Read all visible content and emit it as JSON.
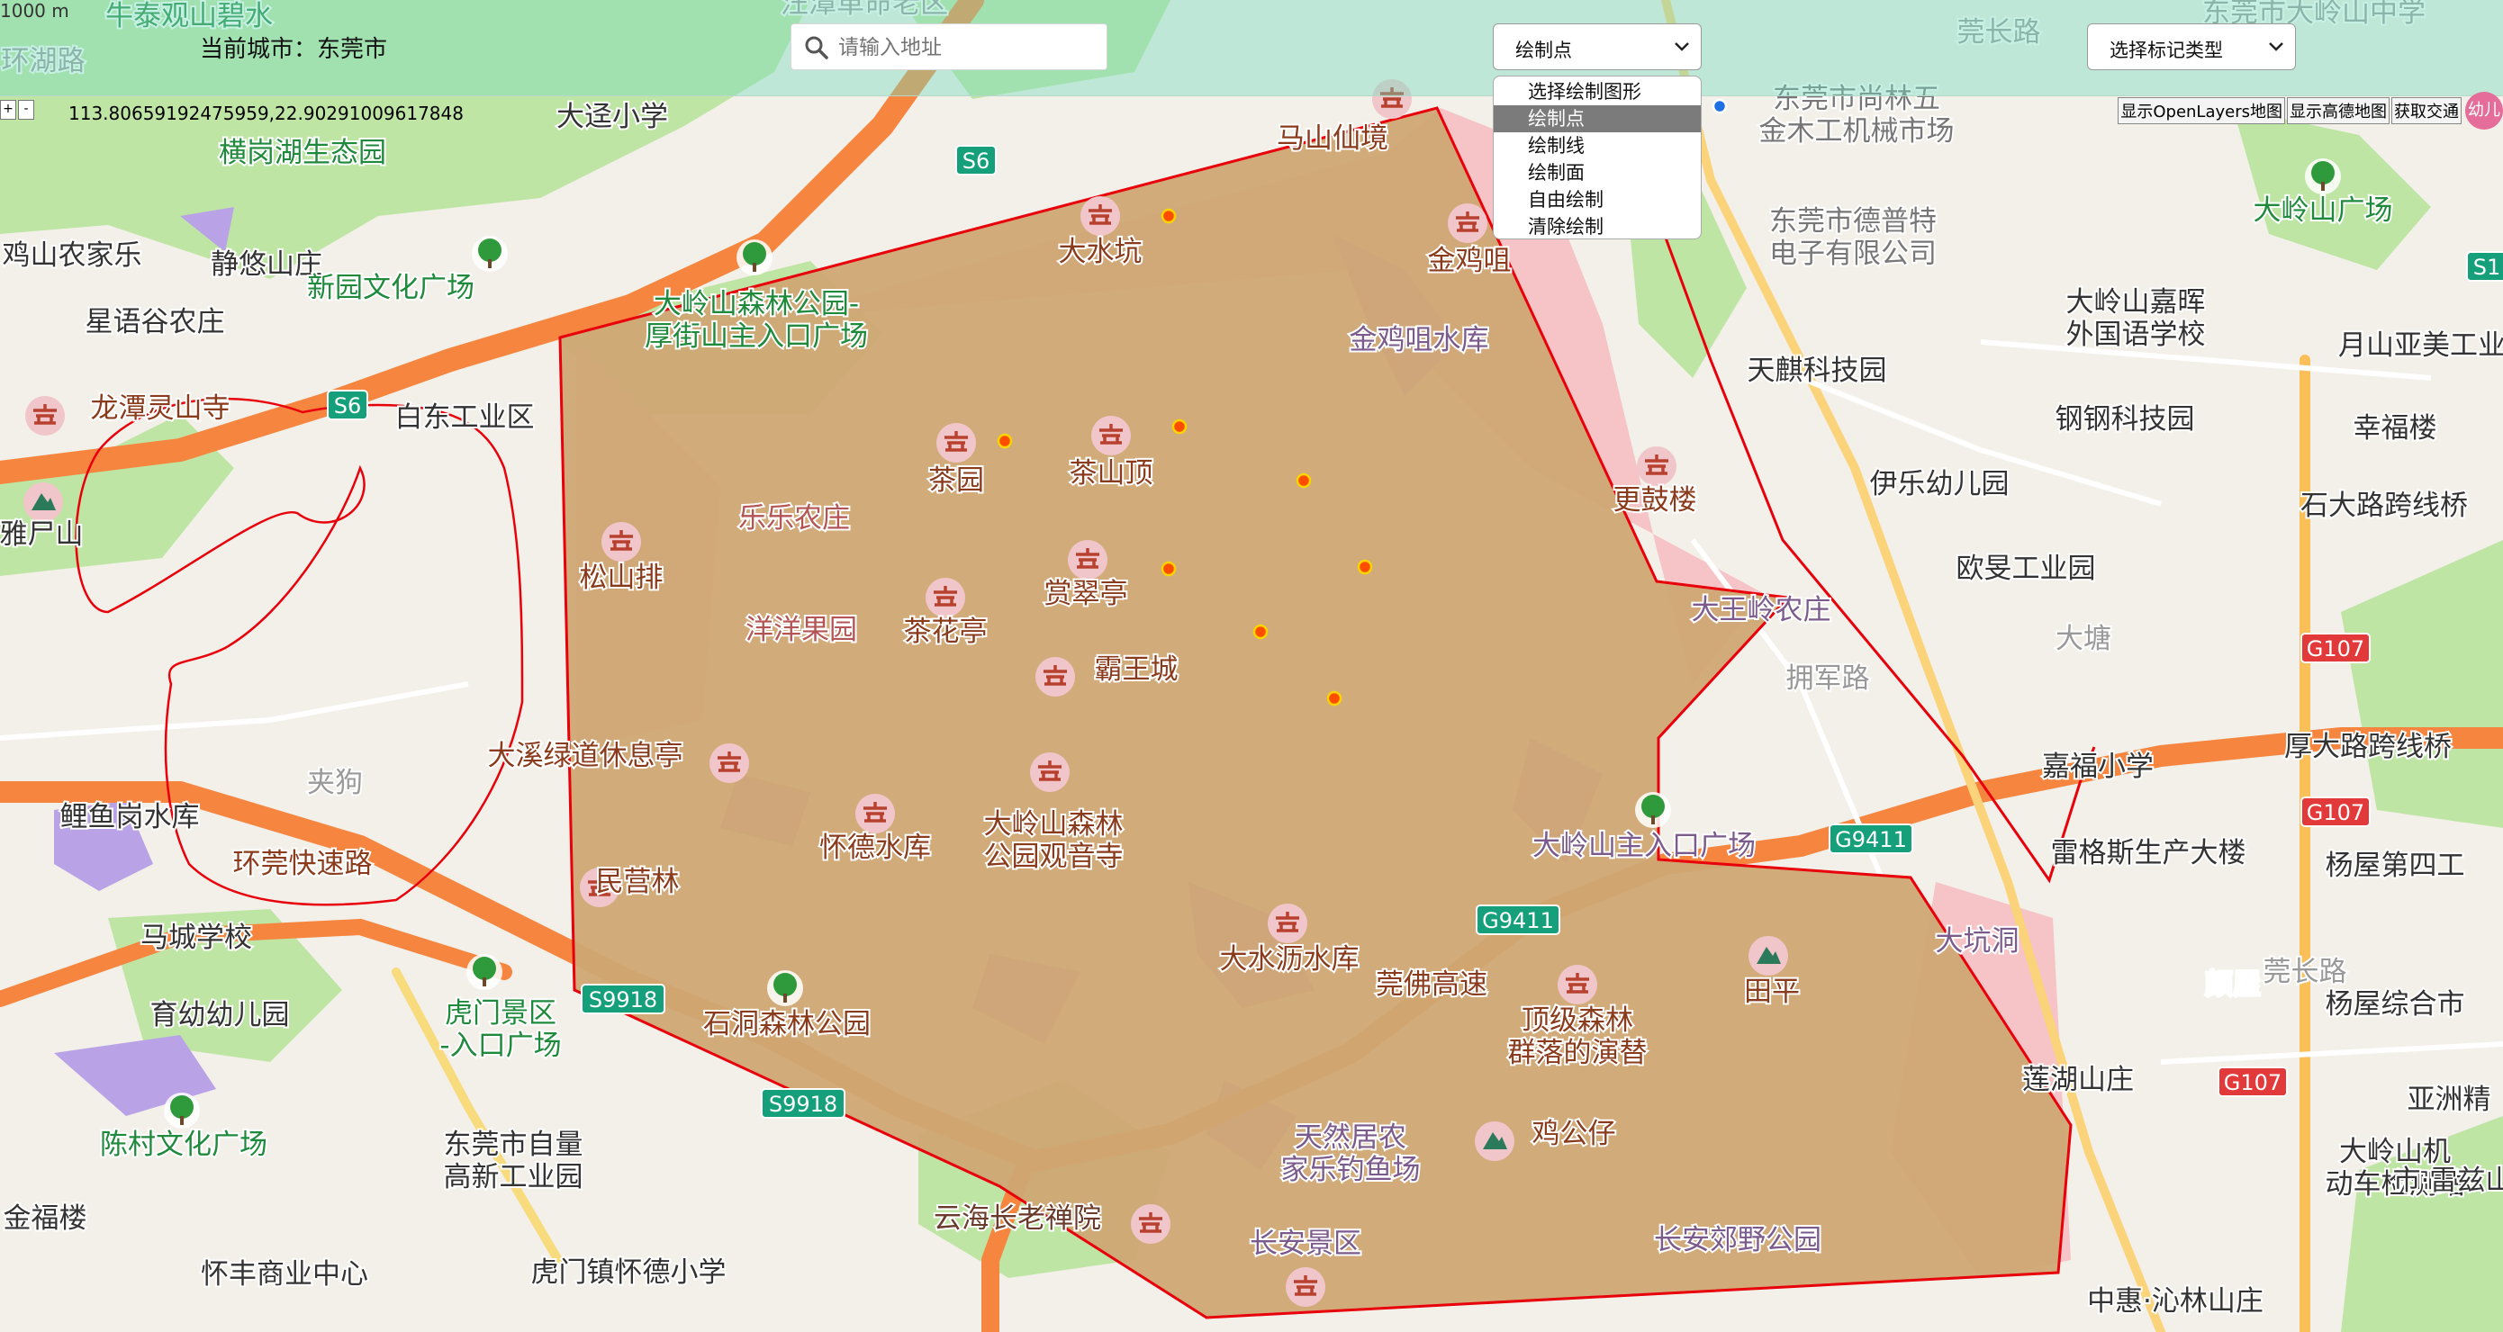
{
  "topbar": {
    "current_city": "当前城市：东莞市",
    "search_placeholder": "请输入地址",
    "draw_select_value": "绘制点",
    "draw_options": [
      "选择绘制图形",
      "绘制点",
      "绘制线",
      "绘制面",
      "自由绘制",
      "清除绘制"
    ],
    "mark_select_value": "选择标记类型"
  },
  "map_controls": {
    "scale": "1000 m",
    "coordinates": "113.80659192475959,22.90291009617848",
    "zoom_in": "+",
    "zoom_out": "-",
    "buttons": [
      "显示OpenLayers地图",
      "显示高德地图",
      "获取交通"
    ],
    "avatar_text": "幼儿"
  },
  "map_labels": [
    "大水坑",
    "金鸡咀",
    "马山仙境",
    "茶园",
    "茶山顶",
    "金鸡咀水库",
    "松山排",
    "乐乐农庄",
    "洋洋果园",
    "茶花亭",
    "赏翠亭",
    "霸王城",
    "大溪绿道休息亭",
    "民营林",
    "怀德水库",
    "大岭山森林\n公园观音寺",
    "大水沥水库",
    "顶级森林\n群落的演替",
    "田平",
    "石洞森林公园",
    "鸡公仔",
    "云海长老禅院",
    "长安郊野公园",
    "大岭山主入口广场",
    "大王岭农庄",
    "更鼓楼",
    "天麒科技园",
    "伊乐幼儿园",
    "欧旻工业园",
    "钢钢科技园",
    "幸福楼",
    "石大路跨线桥",
    "大岭山嘉晖\n外国语学校",
    "月山亚美工业",
    "大岭山广场",
    "东莞市德普特\n电子有限公司",
    "东莞市尚林五\n金木工机械市场",
    "嘉福小学",
    "厚大路跨线桥",
    "雷格斯生产大楼",
    "杨屋第四工",
    "杨屋综合市",
    "亚洲精",
    "莲湖山庄",
    "大岭山机\n动车检测站",
    "中惠·沁林山庄",
    "大坑洞",
    "大塘",
    "颜屋",
    "大迳小学",
    "横岗湖生态园",
    "静悠山庄",
    "新园文化广场",
    "大岭山森林公园-\n厚街山主入口广场",
    "星语谷农庄",
    "龙潭灵山寺",
    "白东工业区",
    "雅尸山",
    "鲤鱼岗水库",
    "夹狗",
    "马城学校",
    "育幼幼儿园",
    "虎门景区\n-入口广场",
    "陈村文化广场",
    "东莞市自量\n高新工业园",
    "金福楼",
    "怀丰商业中心",
    "虎门镇怀德小学",
    "牛泰观山碧水",
    "环湖路",
    "汪潭革命老区",
    "东莞市大岭山中学",
    "莞长路",
    "长安景区",
    "天然居农\n家乐钓鱼场",
    "鸡山农家乐",
    "环莞快速路",
    "莞佛高速",
    "拥军路",
    "莞长路",
    "市·雷兹山庄"
  ],
  "road_shields": [
    "S6",
    "S6",
    "G9411",
    "G9411",
    "S9918",
    "S9918",
    "G107",
    "G107",
    "G107",
    "S1"
  ],
  "colors": {
    "drawn_polygon_fill": "#cfa673",
    "drawn_line": "#e8000b",
    "point_fill": "#ff4d00",
    "point_stroke": "#ffd400",
    "highway": "#f6853f",
    "forest": "#bfe5a5",
    "water": "#b9a3e6"
  }
}
